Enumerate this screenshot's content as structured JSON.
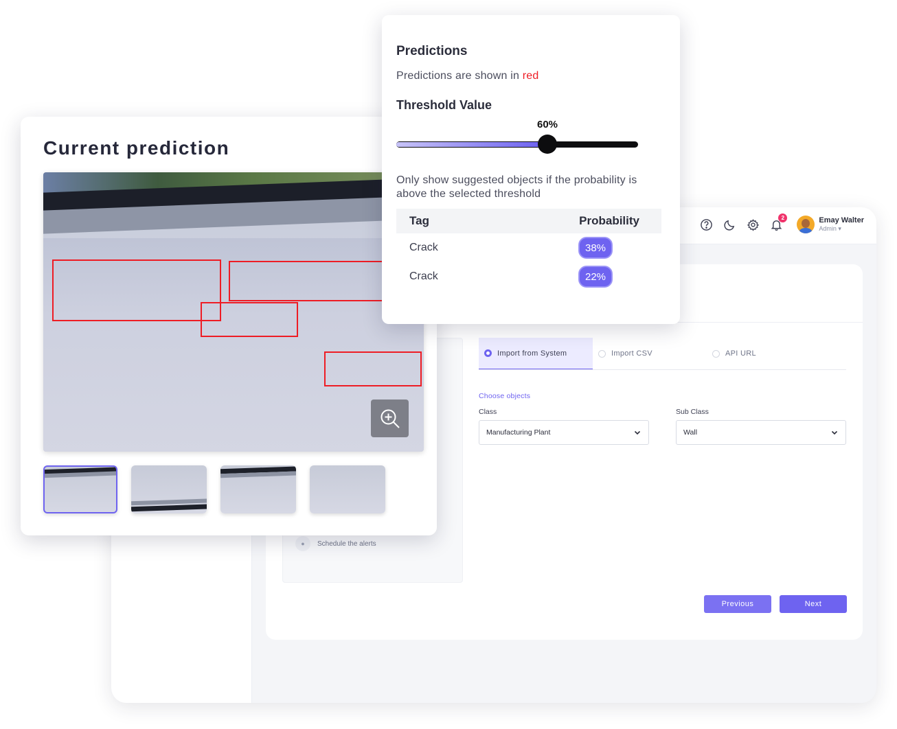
{
  "header": {
    "user_name": "Emay Walter",
    "user_role": "Admin",
    "notification_count": "2",
    "icons": [
      "help-icon",
      "moon-icon",
      "gear-icon",
      "bell-icon"
    ]
  },
  "steps": {
    "schedule_label": "Schedule the alerts"
  },
  "import": {
    "tabs": [
      {
        "label": "Import from System",
        "active": true
      },
      {
        "label": "Import CSV",
        "active": false
      },
      {
        "label": "API URL",
        "active": false
      }
    ],
    "choose_objects_label": "Choose objects",
    "class_label": "Class",
    "class_value": "Manufacturing Plant",
    "subclass_label": "Sub Class",
    "subclass_value": "Wall",
    "previous_label": "Previous",
    "next_label": "Next"
  },
  "prediction_card": {
    "title": "Current prediction",
    "thumbnail_count": 4
  },
  "predictions_panel": {
    "title": "Predictions",
    "subtitle_prefix": "Predictions are shown in ",
    "subtitle_highlight": "red",
    "threshold_title": "Threshold Value",
    "threshold_value": "60%",
    "threshold_fraction": 0.6,
    "description": "Only show suggested objects if the probability is above the selected threshold",
    "table": {
      "headers": [
        "Tag",
        "Probability"
      ],
      "rows": [
        {
          "tag": "Crack",
          "probability": "38%"
        },
        {
          "tag": "Crack",
          "probability": "22%"
        }
      ]
    }
  },
  "colors": {
    "accent": "#6e63f0",
    "prediction": "#ee1c24"
  }
}
